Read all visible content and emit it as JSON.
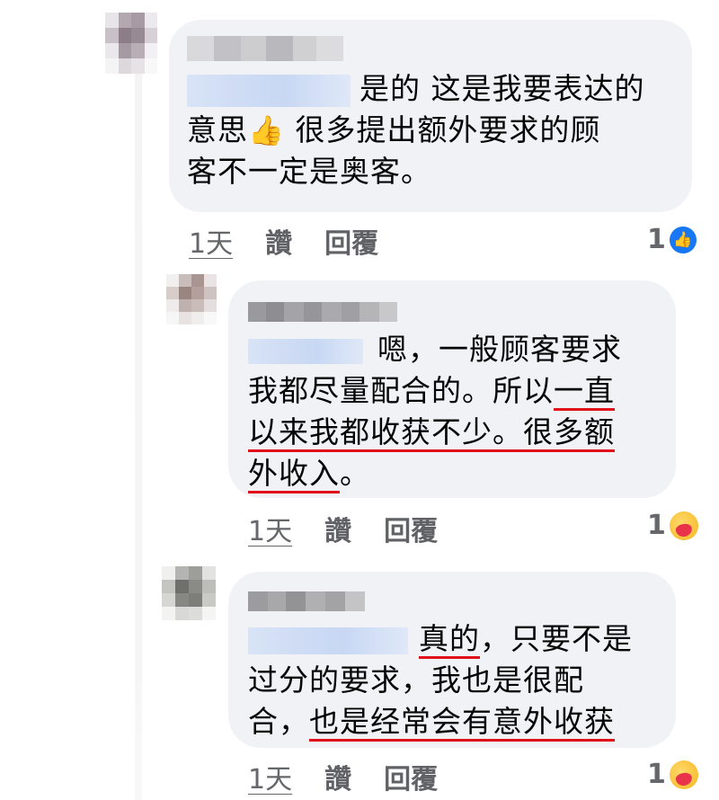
{
  "comments": [
    {
      "lines": [
        {
          "segments": [
            {
              "text": "是的 这是我要表达的",
              "ul": false
            }
          ]
        },
        {
          "segments": [
            {
              "text": "意思",
              "ul": false
            },
            {
              "text": "👍",
              "ul": false
            },
            {
              "text": " 很多提出额外要求的顾",
              "ul": false
            }
          ]
        },
        {
          "segments": [
            {
              "text": "客不一定是奥客。",
              "ul": false
            }
          ]
        }
      ],
      "time": "1天",
      "like_label": "讚",
      "reply_label": "回覆",
      "reaction_count": "1",
      "reaction_icon": "like-icon"
    },
    {
      "lines": [
        {
          "segments": [
            {
              "text": "嗯，一般顾客要求",
              "ul": false
            }
          ]
        },
        {
          "segments": [
            {
              "text": "我都尽量配合的。所以",
              "ul": false
            },
            {
              "text": "一直",
              "ul": true
            }
          ]
        },
        {
          "segments": [
            {
              "text": "以来我都收获不少。很多额",
              "ul": true
            }
          ]
        },
        {
          "segments": [
            {
              "text": "外收入",
              "ul": true
            },
            {
              "text": "。",
              "ul": false
            }
          ]
        }
      ],
      "time": "1天",
      "like_label": "讚",
      "reply_label": "回覆",
      "reaction_count": "1",
      "reaction_icon": "care-icon"
    },
    {
      "lines": [
        {
          "segments": [
            {
              "text": "真的",
              "ul": true
            },
            {
              "text": "，只要不是",
              "ul": false
            }
          ]
        },
        {
          "segments": [
            {
              "text": "过分的要求，我也是很配",
              "ul": false
            }
          ]
        },
        {
          "segments": [
            {
              "text": "合，",
              "ul": false
            },
            {
              "text": "也是经常会有意外收获",
              "ul": true
            }
          ]
        }
      ],
      "time": "1天",
      "like_label": "讚",
      "reply_label": "回覆",
      "reaction_count": "1",
      "reaction_icon": "care-icon"
    }
  ],
  "colors": {
    "bubble": "#f0f2f5",
    "underline": "#e0101a",
    "meta_text": "#65676b",
    "like_blue": "#1877f2"
  }
}
